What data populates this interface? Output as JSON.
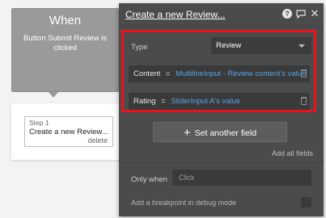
{
  "event": {
    "title": "When",
    "description": "Button Submit Review is clicked"
  },
  "steps": [
    {
      "number_label": "Step 1",
      "name": "Create a new Review...",
      "delete_label": "delete"
    }
  ],
  "panel": {
    "title": "Create a new Review...",
    "icons": [
      "help-icon",
      "comment-icon",
      "close-icon"
    ],
    "type_label": "Type",
    "type_value": "Review",
    "fields": [
      {
        "name": "Content",
        "eq": "=",
        "value": "MultilineInput - Review content's value"
      },
      {
        "name": "Rating",
        "eq": "=",
        "value": "SliderInput A's value"
      }
    ],
    "set_field_label": "Set another field",
    "add_all_label": "Add all fields",
    "only_when_label": "Only when",
    "only_when_placeholder": "Click",
    "breakpoint_label": "Add a breakpoint in debug mode"
  },
  "colors": {
    "highlight": "#e8131b",
    "dynamic_value": "#57a3e7",
    "panel_bg": "#4b4b4b"
  }
}
